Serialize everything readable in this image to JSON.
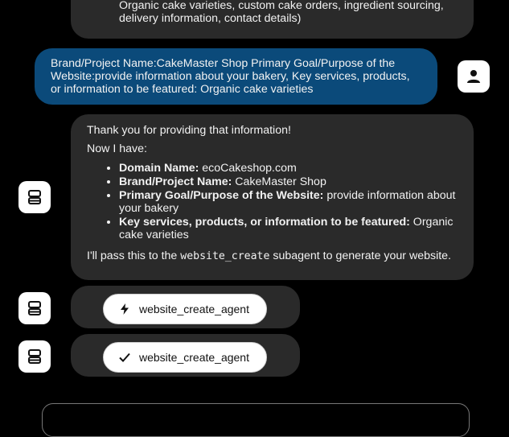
{
  "messages": {
    "prev_assistant_tail": {
      "line1": "Organic cake varieties, custom cake orders, ingredient sourcing,",
      "line2": "delivery information, contact details)"
    },
    "user_message": {
      "line1": "Brand/Project Name:CakeMaster Shop Primary Goal/Purpose of the",
      "line2": "Website:provide information about your bakery, Key services, products,",
      "line3": "or information to be featured: Organic cake varieties"
    },
    "assistant_reply": {
      "thanks": "Thank you for providing that information!",
      "now_have": "Now I have:",
      "items": [
        {
          "label": "Domain Name:",
          "value": " ecoCakeshop.com"
        },
        {
          "label": "Brand/Project Name:",
          "value": " CakeMaster Shop"
        },
        {
          "label": "Primary Goal/Purpose of the Website:",
          "value": " provide information about your bakery"
        },
        {
          "label": "Key services, products, or information to be featured:",
          "value": " Organic cake varieties"
        }
      ],
      "closing_prefix": "I'll pass this to the ",
      "closing_code": "website_create",
      "closing_suffix": " subagent to generate your website."
    },
    "tool_calls": [
      {
        "name": "website_create_agent",
        "status_icon": "lightning-icon"
      },
      {
        "name": "website_create_agent",
        "status_icon": "checkmark-icon"
      }
    ]
  },
  "icons": {
    "user_avatar": "user-icon",
    "assistant_avatar": "robot-icon"
  },
  "colors": {
    "background": "#000000",
    "assistant_bubble": "#2a2a2a",
    "user_bubble": "#0b4a7a",
    "avatar_bg": "#ffffff"
  }
}
